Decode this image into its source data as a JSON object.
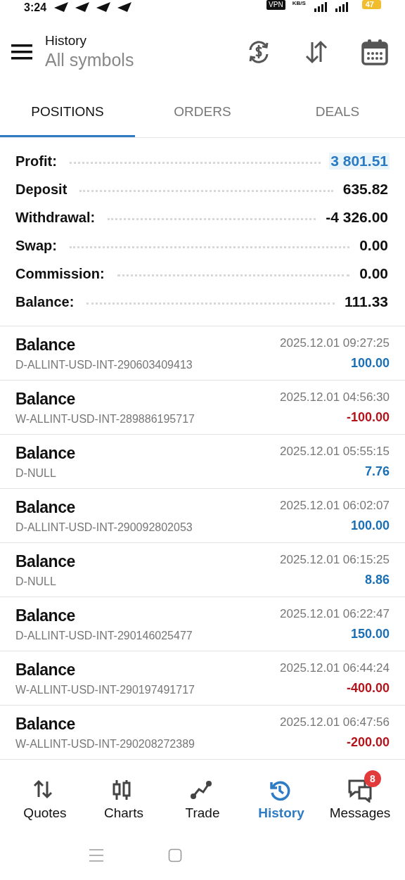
{
  "status_bar": {
    "time": "3:24",
    "vpn": "VPN",
    "speed_unit": "KB/S",
    "battery": "47"
  },
  "header": {
    "title": "History",
    "subtitle": "All symbols"
  },
  "tabs": [
    {
      "label": "POSITIONS",
      "selected": true
    },
    {
      "label": "ORDERS",
      "selected": false
    },
    {
      "label": "DEALS",
      "selected": false
    }
  ],
  "summary": [
    {
      "label": "Profit:",
      "value": "3 801.51",
      "highlight": true
    },
    {
      "label": "Deposit",
      "value": "635.82",
      "highlight": false
    },
    {
      "label": "Withdrawal:",
      "value": "-4 326.00",
      "highlight": false
    },
    {
      "label": "Swap:",
      "value": "0.00",
      "highlight": false
    },
    {
      "label": "Commission:",
      "value": "0.00",
      "highlight": false
    },
    {
      "label": "Balance:",
      "value": "111.33",
      "highlight": false
    }
  ],
  "deals": [
    {
      "type": "Balance",
      "comment": "D-ALLINT-USD-INT-290603409413",
      "time": "2025.12.01 09:27:25",
      "amount": "100.00",
      "color": "#1a6fb5"
    },
    {
      "type": "Balance",
      "comment": "W-ALLINT-USD-INT-289886195717",
      "time": "2025.12.01 04:56:30",
      "amount": "-100.00",
      "color": "#b3141c"
    },
    {
      "type": "Balance",
      "comment": "D-NULL",
      "time": "2025.12.01 05:55:15",
      "amount": "7.76",
      "color": "#1a6fb5"
    },
    {
      "type": "Balance",
      "comment": "D-ALLINT-USD-INT-290092802053",
      "time": "2025.12.01 06:02:07",
      "amount": "100.00",
      "color": "#1a6fb5"
    },
    {
      "type": "Balance",
      "comment": "D-NULL",
      "time": "2025.12.01 06:15:25",
      "amount": "8.86",
      "color": "#1a6fb5"
    },
    {
      "type": "Balance",
      "comment": "D-ALLINT-USD-INT-290146025477",
      "time": "2025.12.01 06:22:47",
      "amount": "150.00",
      "color": "#1a6fb5"
    },
    {
      "type": "Balance",
      "comment": "W-ALLINT-USD-INT-290197491717",
      "time": "2025.12.01 06:44:24",
      "amount": "-400.00",
      "color": "#b3141c"
    },
    {
      "type": "Balance",
      "comment": "W-ALLINT-USD-INT-290208272389",
      "time": "2025.12.01 06:47:56",
      "amount": "-200.00",
      "color": "#b3141c"
    }
  ],
  "bottom_nav": [
    {
      "label": "Quotes",
      "kind": "quotes",
      "selected": false
    },
    {
      "label": "Charts",
      "kind": "charts",
      "selected": false
    },
    {
      "label": "Trade",
      "kind": "trade",
      "selected": false
    },
    {
      "label": "History",
      "kind": "history",
      "selected": true
    },
    {
      "label": "Messages",
      "kind": "messages",
      "selected": false,
      "badge": "8"
    }
  ]
}
